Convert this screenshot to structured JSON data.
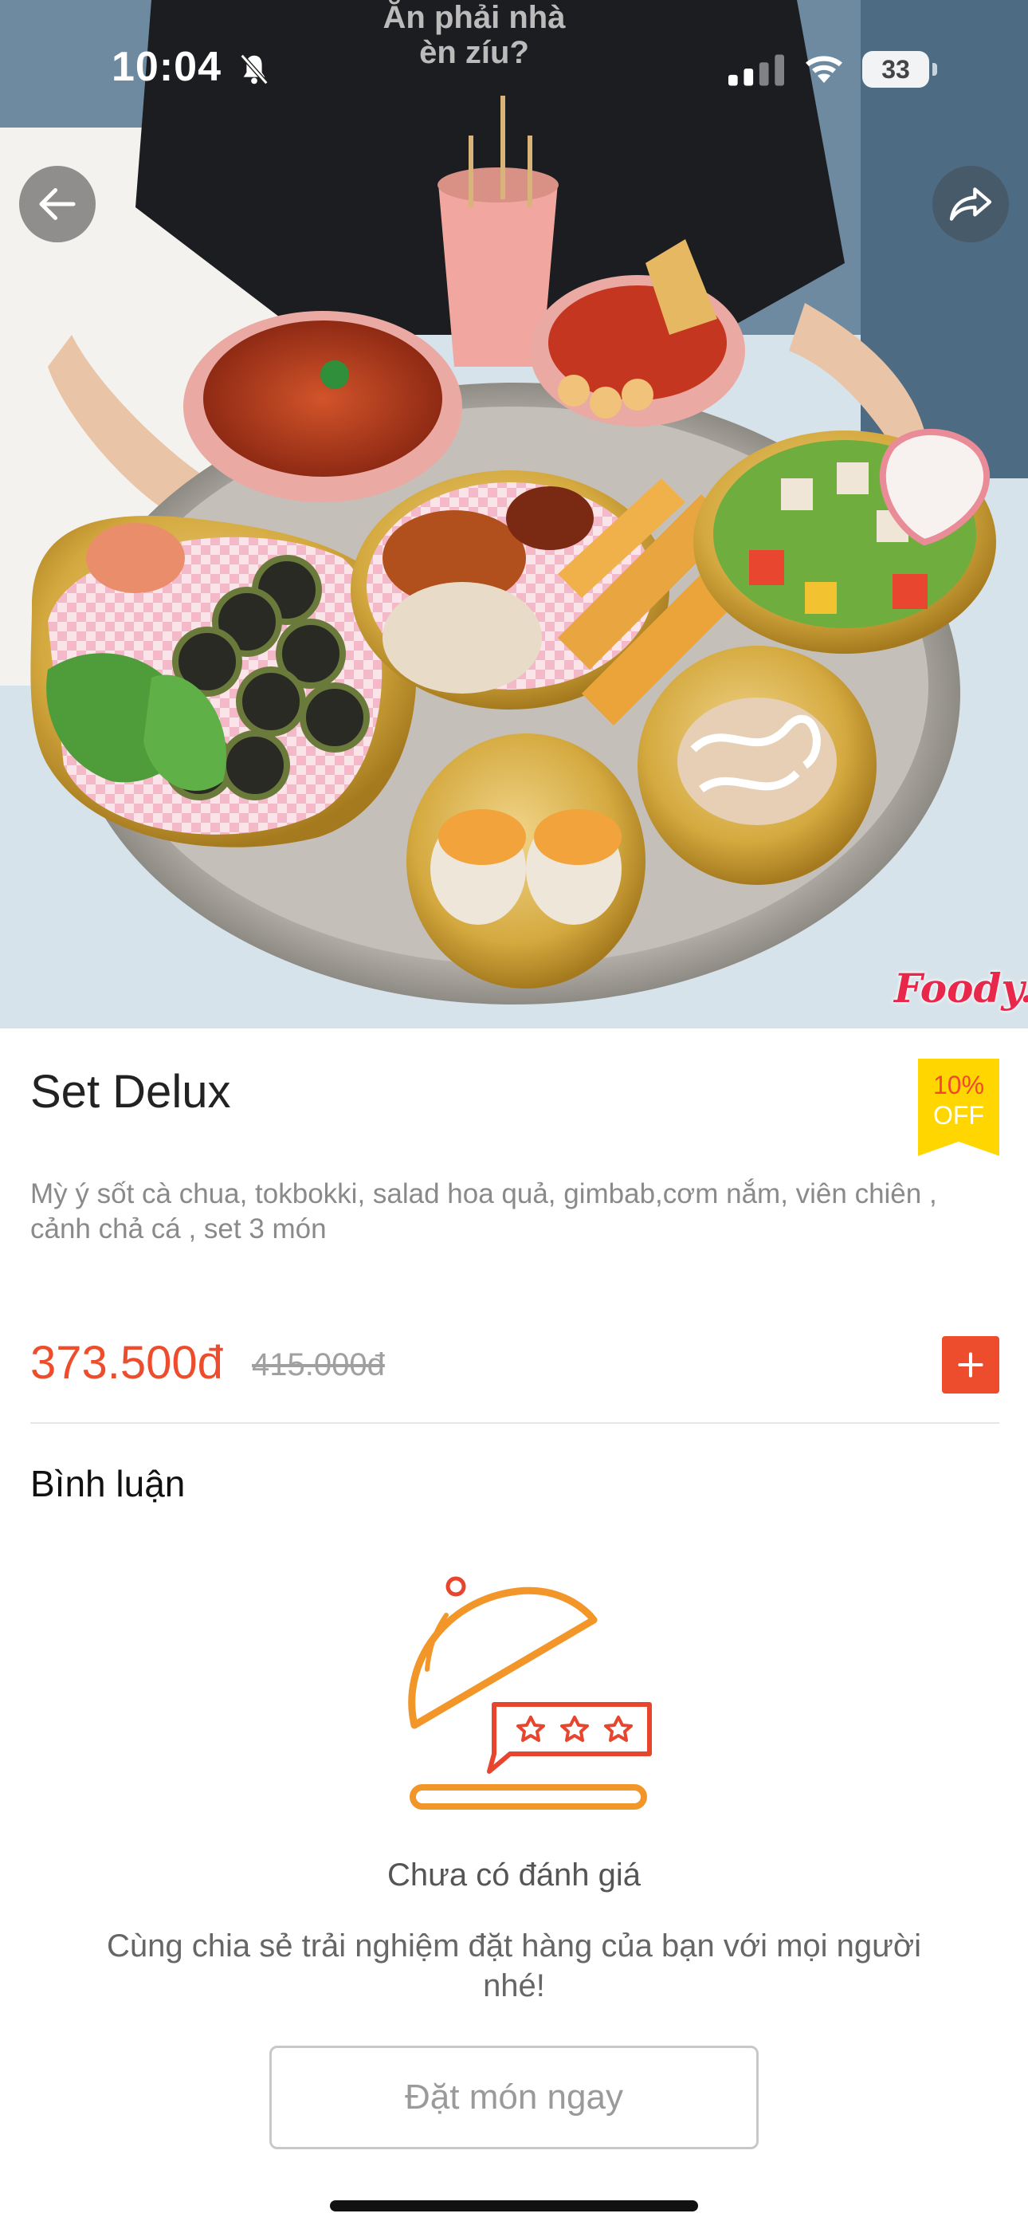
{
  "status_bar": {
    "time": "10:04",
    "battery_level": "33",
    "icons": [
      "bell-off-icon",
      "signal-icon",
      "wifi-icon",
      "battery-icon"
    ]
  },
  "navigation": {
    "back_icon": "arrow-left-icon",
    "share_icon": "share-icon"
  },
  "photo": {
    "watermark": "Foody.vn",
    "shirt_text": "Ăn phải nhà\nèn zíu?"
  },
  "product": {
    "title": "Set Delux",
    "discount": {
      "percent": "10%",
      "label": "OFF"
    },
    "description": "Mỳ ý sốt cà chua, tokbokki, salad hoa quả, gimbab,cơm nắm, viên chiên , cảnh chả cá , set 3 món",
    "price_current": "373.500đ",
    "price_original": "415.000đ",
    "add_icon": "plus-icon"
  },
  "reviews": {
    "heading": "Bình luận",
    "illustration_icon": "food-cloche-rating-icon",
    "empty_title": "Chưa có đánh giá",
    "empty_subtitle": "Cùng chia sẻ trải nghiệm đặt hàng của bạn với mọi người nhé!",
    "cta_label": "Đặt món ngay"
  },
  "colors": {
    "accent": "#ee4d2d",
    "badge": "#ffd600",
    "illustration_orange": "#f2962a",
    "illustration_red": "#e8452f"
  }
}
